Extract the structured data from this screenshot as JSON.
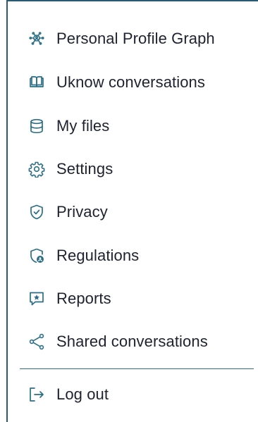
{
  "accent_color": "#2b6f87",
  "menu": {
    "items": [
      {
        "label": "Personal Profile Graph",
        "icon": "profile-graph-icon"
      },
      {
        "label": "Uknow conversations",
        "icon": "book-icon"
      },
      {
        "label": "My files",
        "icon": "database-icon"
      },
      {
        "label": "Settings",
        "icon": "gear-icon"
      },
      {
        "label": "Privacy",
        "icon": "shield-check-icon"
      },
      {
        "label": "Regulations",
        "icon": "shield-user-icon"
      },
      {
        "label": "Reports",
        "icon": "star-comment-icon"
      },
      {
        "label": "Shared conversations",
        "icon": "share-icon"
      }
    ],
    "logout": {
      "label": "Log out",
      "icon": "logout-icon"
    }
  }
}
